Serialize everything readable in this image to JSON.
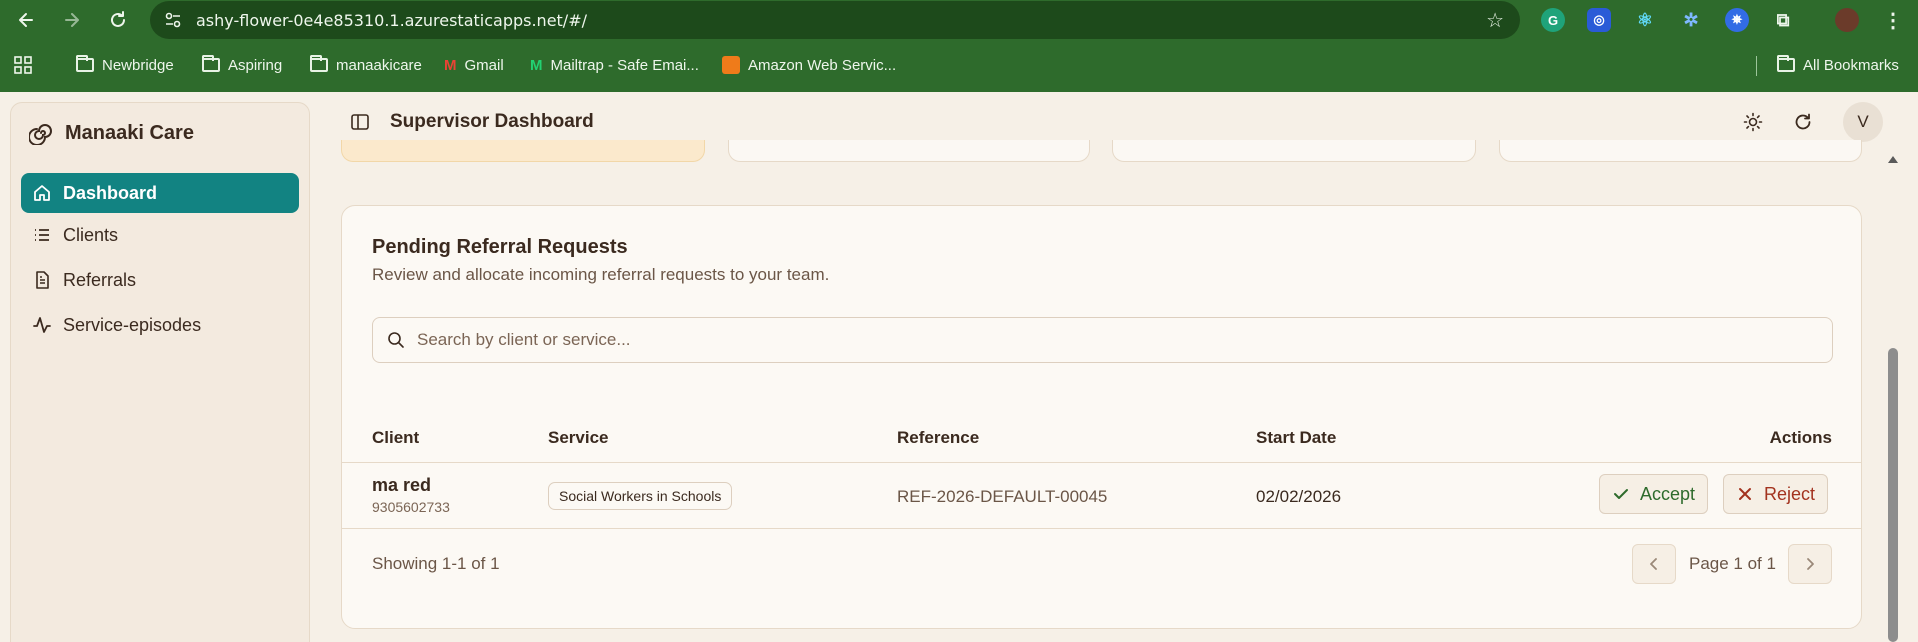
{
  "browser": {
    "url": "ashy-flower-0e4e85310.1.azurestaticapps.net/#/",
    "bookmarks": [
      "Newbridge",
      "Aspiring",
      "manaakicare",
      "Gmail",
      "Mailtrap - Safe Emai...",
      "Amazon Web Servic..."
    ],
    "all_bookmarks": "All Bookmarks"
  },
  "sidebar": {
    "brand": "Manaaki Care",
    "items": [
      {
        "label": "Dashboard",
        "icon": "home-icon"
      },
      {
        "label": "Clients",
        "icon": "list-icon"
      },
      {
        "label": "Referrals",
        "icon": "document-icon"
      },
      {
        "label": "Service-episodes",
        "icon": "activity-icon"
      }
    ]
  },
  "header": {
    "title": "Supervisor Dashboard",
    "avatar": "V"
  },
  "referrals": {
    "title": "Pending Referral Requests",
    "subtitle": "Review and allocate incoming referral requests to your team.",
    "search_placeholder": "Search by client or service...",
    "columns": [
      "Client",
      "Service",
      "Reference",
      "Start Date",
      "Actions"
    ],
    "rows": [
      {
        "client": "ma red",
        "client_id": "9305602733",
        "service": "Social Workers in Schools",
        "reference": "REF-2026-DEFAULT-00045",
        "start_date": "02/02/2026",
        "accept": "Accept",
        "reject": "Reject"
      }
    ],
    "showing": "Showing 1-1 of 1",
    "page": "Page 1 of 1"
  },
  "colors": {
    "chrome": "#2e6b2c",
    "accent": "#128382",
    "accept": "#2e6b2c",
    "reject": "#a3331f"
  }
}
